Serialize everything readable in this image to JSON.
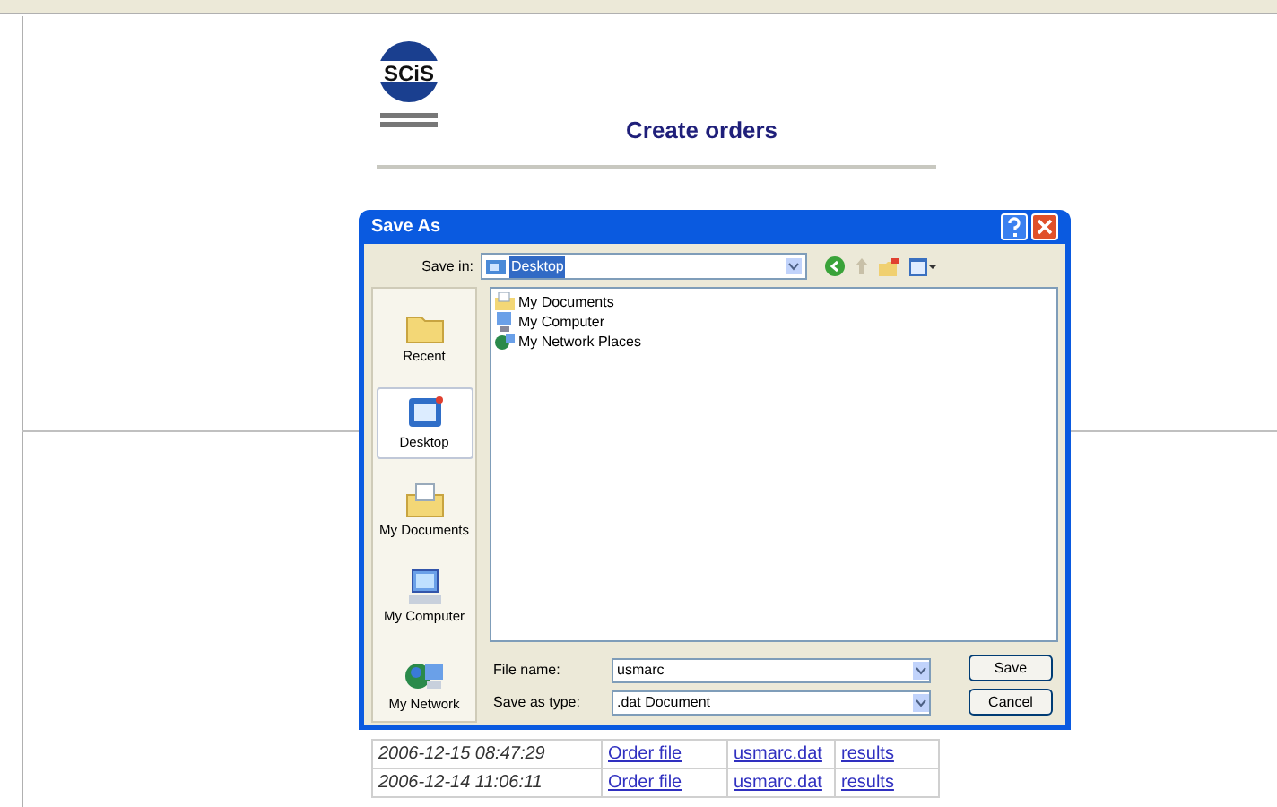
{
  "page": {
    "logo": "SCiS",
    "title": "Create orders"
  },
  "orders": [
    {
      "date": "2006-12-15 08:47:29",
      "order": "Order file",
      "file": "usmarc.dat",
      "results": "results"
    },
    {
      "date": "2006-12-14 11:06:11",
      "order": "Order file",
      "file": "usmarc.dat",
      "results": "results"
    }
  ],
  "dialog": {
    "title": "Save As",
    "save_in_label": "Save in:",
    "save_in_value": "Desktop",
    "places": [
      {
        "label": "Recent",
        "selected": false
      },
      {
        "label": "Desktop",
        "selected": true
      },
      {
        "label": "My Documents",
        "selected": false
      },
      {
        "label": "My Computer",
        "selected": false
      },
      {
        "label": "My Network",
        "selected": false
      }
    ],
    "files": [
      "My Documents",
      "My Computer",
      "My Network Places"
    ],
    "file_name_label": "File name:",
    "file_name": "usmarc",
    "type_label": "Save as type:",
    "type": ".dat Document",
    "buttons": [
      "Save",
      "Cancel"
    ]
  }
}
